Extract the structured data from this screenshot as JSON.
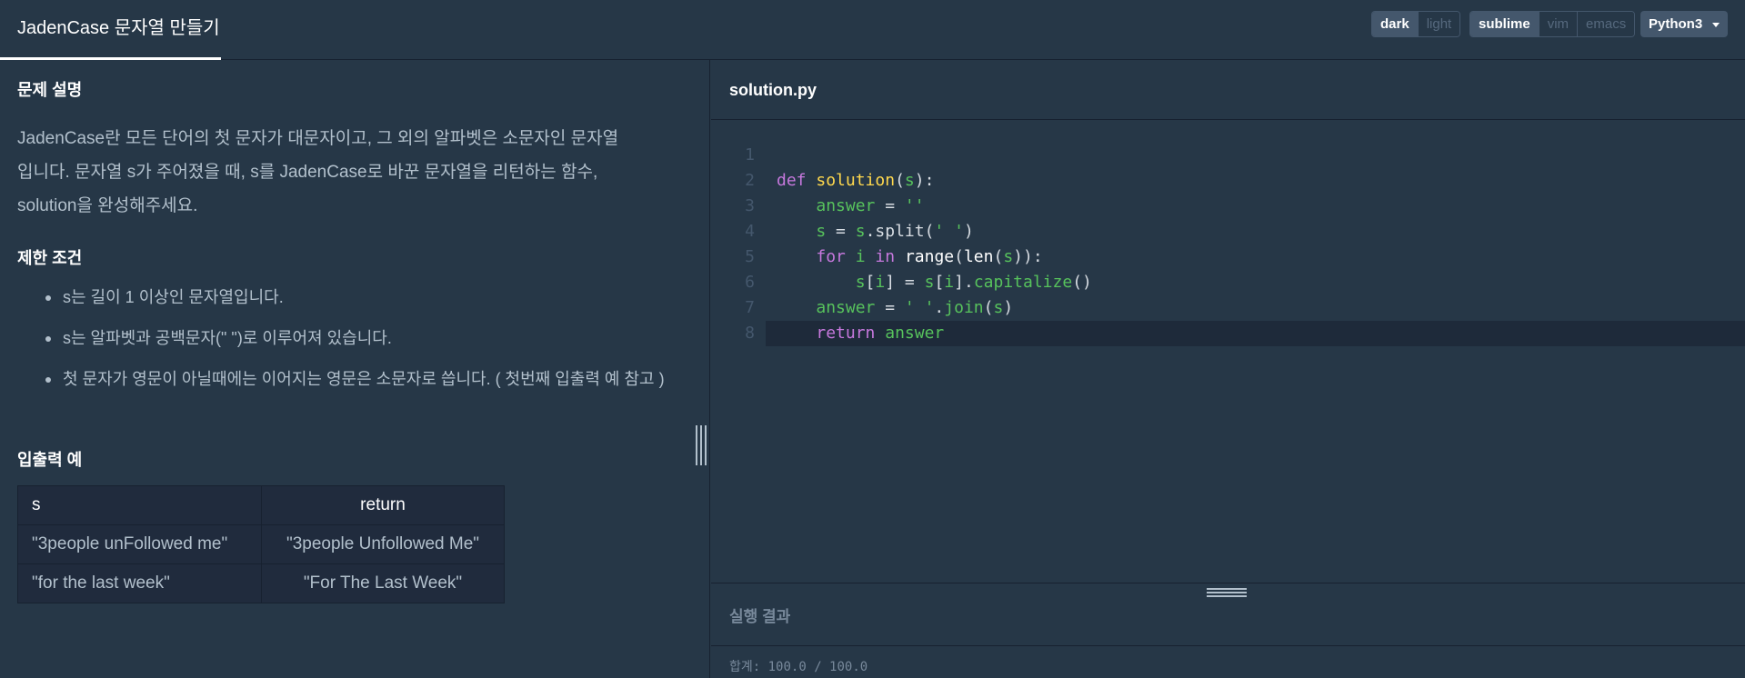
{
  "header": {
    "title": "JadenCase 문자열 만들기",
    "theme_options": [
      "dark",
      "light"
    ],
    "keymap_options": [
      "sublime",
      "vim",
      "emacs"
    ],
    "language": "Python3"
  },
  "problem": {
    "desc_heading": "문제 설명",
    "desc_line1": "JadenCase란 모든 단어의 첫 문자가 대문자이고, 그 외의 알파벳은 소문자인 문자열",
    "desc_line2": "입니다. 문자열 s가 주어졌을 때, s를 JadenCase로 바꾼 문자열을 리턴하는 함수,",
    "desc_line3": "solution을 완성해주세요.",
    "limits_heading": "제한 조건",
    "limits": [
      "s는 길이 1 이상인 문자열입니다.",
      "s는 알파벳과 공백문자(\" \")로 이루어져 있습니다.",
      "첫 문자가 영문이 아닐때에는 이어지는 영문은 소문자로 씁니다. ( 첫번째 입출력 예 참고 )"
    ],
    "io_heading": "입출력 예",
    "io_headers": [
      "s",
      "return"
    ],
    "io_rows": [
      [
        "\"3people unFollowed me\"",
        "\"3people Unfollowed Me\""
      ],
      [
        "\"for the last week\"",
        "\"For The Last Week\""
      ]
    ]
  },
  "editor": {
    "filename": "solution.py",
    "line_numbers": [
      "1",
      "2",
      "3",
      "4",
      "5",
      "6",
      "7",
      "8"
    ],
    "current_line": 8
  },
  "result": {
    "title": "실행 결과",
    "score": "합계: 100.0 / 100.0"
  }
}
